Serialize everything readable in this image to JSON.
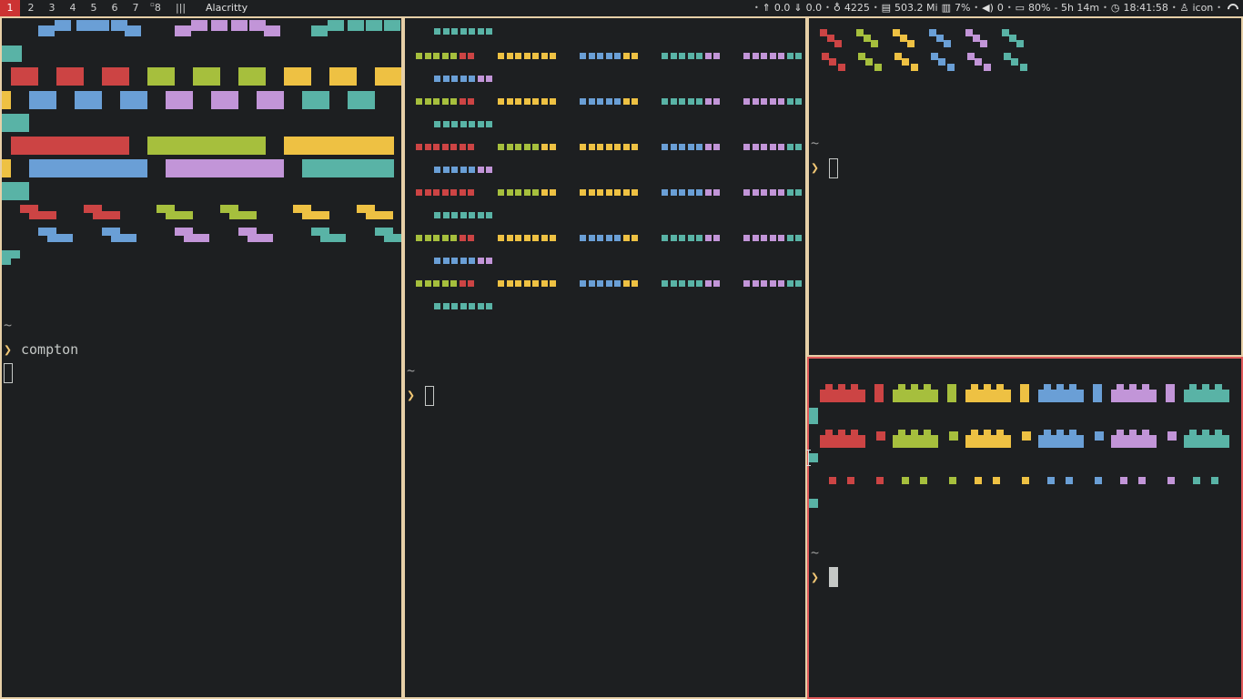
{
  "colors": {
    "red": "#cc4444",
    "green": "#a6bf3d",
    "yellow": "#eec143",
    "blue": "#6a9fd6",
    "magenta": "#c295d8",
    "cyan": "#59b3a6",
    "orange": "#f0c674",
    "focused_border": "#e05a5a",
    "unfocused_border": "#e6cfa7",
    "active_workspace": "#cc3333"
  },
  "topbar": {
    "workspaces": [
      {
        "label": "1",
        "active": true
      },
      {
        "label": "2"
      },
      {
        "label": "3"
      },
      {
        "label": "4"
      },
      {
        "label": "5"
      },
      {
        "label": "6"
      },
      {
        "label": "7"
      },
      {
        "label": "8",
        "marked": true
      }
    ],
    "layout_symbol": "|||",
    "window_title": "Alacritty",
    "status": {
      "upload": "0.0",
      "download": "0.0",
      "brightness": "4225",
      "memory": "503.2 Mi",
      "cpu": "7%",
      "volume": "0",
      "battery": "80%",
      "battery_time": "- 5h 14m",
      "clock": "18:41:58",
      "tray_label": "icon"
    },
    "icons": [
      "up-arrow-icon",
      "down-arrow-icon",
      "lightbulb-icon",
      "memory-icon",
      "cpu-icon",
      "volume-icon",
      "battery-icon",
      "clock-icon",
      "user-icon",
      "wifi-icon"
    ]
  },
  "panes": {
    "pane1": {
      "home": "~",
      "prompt_symbol": "❯",
      "command": "compton"
    },
    "pane2": {
      "home": "~",
      "prompt_symbol": "❯"
    },
    "pane3": {
      "home": "~",
      "prompt_symbol": "❯"
    },
    "pane4": {
      "home": "~",
      "prompt_symbol": "❯"
    }
  }
}
